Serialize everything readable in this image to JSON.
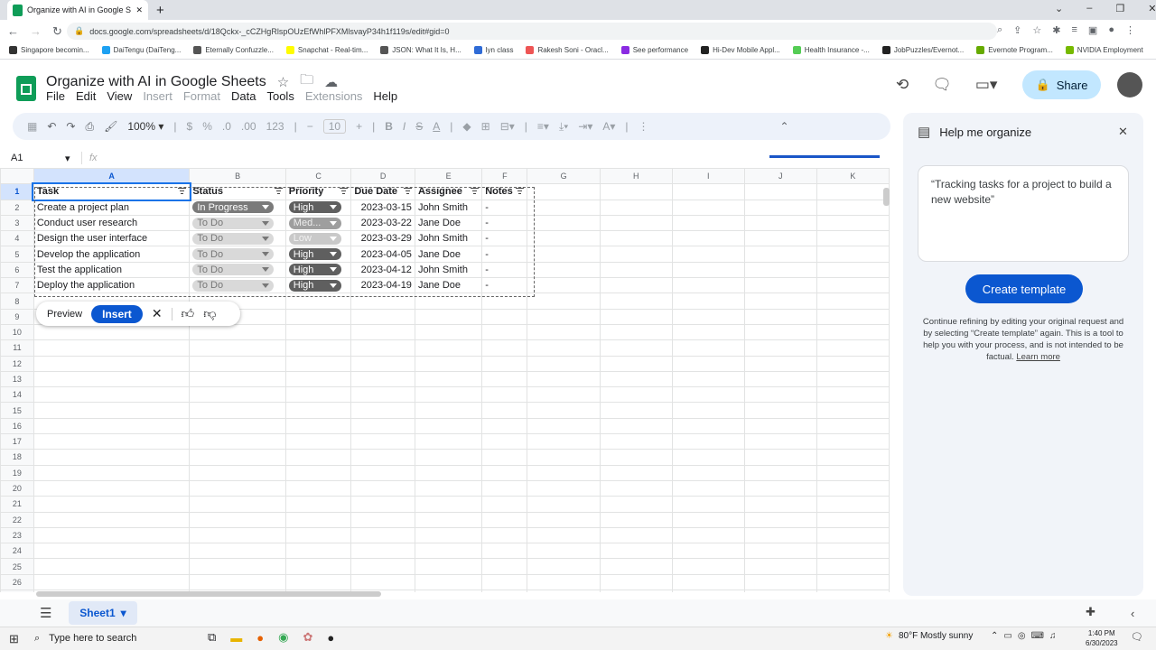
{
  "browser": {
    "tab_title": "Organize with AI in Google Shee",
    "url": "docs.google.com/spreadsheets/d/18Qckx-_cCZHgRlspOUzEfWhlPFXMlsvayP34h1f119s/edit#gid=0",
    "bookmarks": [
      "Singapore becomin...",
      "DaiTengu (DaiTeng...",
      "Eternally Confuzzle...",
      "Snapchat - Real-tim...",
      "JSON: What It Is, H...",
      "lyn class",
      "Rakesh Soni - Oracl...",
      "See performance",
      "Hi-Dev Mobile Appl...",
      "Health Insurance -...",
      "JobPuzzles/Evernot...",
      "Evernote Program...",
      "NVIDIA Employment"
    ]
  },
  "doc": {
    "title": "Organize with AI in Google Sheets",
    "menu": [
      "File",
      "Edit",
      "View",
      "Insert",
      "Format",
      "Data",
      "Tools",
      "Extensions",
      "Help"
    ],
    "share_label": "Share"
  },
  "toolbar": {
    "zoom": "100%",
    "font_size": "10",
    "percent": "%",
    "num": "123",
    "currency": "$"
  },
  "formula": {
    "cell_ref": "A1",
    "fx": "fx"
  },
  "sheet": {
    "columns": [
      "A",
      "B",
      "C",
      "D",
      "E",
      "F",
      "G",
      "H",
      "I",
      "J",
      "K"
    ],
    "headers": [
      "Task",
      "Status",
      "Priority",
      "Due Date",
      "Assignee",
      "Notes"
    ],
    "rows": [
      {
        "task": "Create a project plan",
        "status": "In Progress",
        "priority": "High",
        "due": "2023-03-15",
        "assignee": "John Smith",
        "notes": "-"
      },
      {
        "task": "Conduct user research",
        "status": "To Do",
        "priority": "Med...",
        "due": "2023-03-22",
        "assignee": "Jane Doe",
        "notes": "-"
      },
      {
        "task": "Design the user interface",
        "status": "To Do",
        "priority": "Low",
        "due": "2023-03-29",
        "assignee": "John Smith",
        "notes": "-"
      },
      {
        "task": "Develop the application",
        "status": "To Do",
        "priority": "High",
        "due": "2023-04-05",
        "assignee": "Jane Doe",
        "notes": "-"
      },
      {
        "task": "Test the application",
        "status": "To Do",
        "priority": "High",
        "due": "2023-04-12",
        "assignee": "John Smith",
        "notes": "-"
      },
      {
        "task": "Deploy the application",
        "status": "To Do",
        "priority": "High",
        "due": "2023-04-19",
        "assignee": "Jane Doe",
        "notes": "-"
      }
    ],
    "tab_name": "Sheet1"
  },
  "aibar": {
    "preview": "Preview",
    "insert": "Insert"
  },
  "panel": {
    "title": "Help me organize",
    "prompt": "“Tracking tasks for a project to build a new website”",
    "create": "Create template",
    "note_1": "Continue refining by editing your original request and by selecting “Create template” again.",
    "note_2": "This is a tool to help you with your process, and is not intended to be factual.",
    "learn_more": "Learn more"
  },
  "taskbar": {
    "search": "Type here to search",
    "weather": "80°F  Mostly sunny",
    "time": "1:40 PM",
    "date": "6/30/2023"
  }
}
